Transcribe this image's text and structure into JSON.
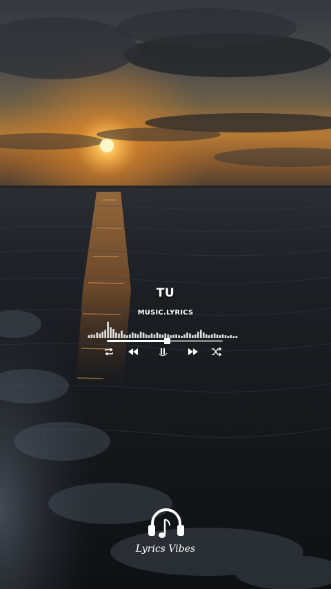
{
  "song": {
    "title": "TU",
    "artist": "MUSIC.LYRICS"
  },
  "player": {
    "progress": 0.52,
    "controls": {
      "repeat_icon": "repeat-icon",
      "previous_icon": "rewind-icon",
      "play_pause_icon": "pause-icon",
      "next_icon": "fast-forward-icon",
      "shuffle_icon": "shuffle-icon"
    },
    "visualizer_levels": [
      0.15,
      0.2,
      0.18,
      0.3,
      0.25,
      0.35,
      0.45,
      0.9,
      0.6,
      0.5,
      0.3,
      0.25,
      0.4,
      0.2,
      0.15,
      0.2,
      0.3,
      0.25,
      0.2,
      0.35,
      0.3,
      0.2,
      0.15,
      0.25,
      0.2,
      0.3,
      0.22,
      0.18,
      0.25,
      0.2,
      0.15,
      0.18,
      0.2,
      0.15,
      0.12,
      0.2,
      0.3,
      0.25,
      0.15,
      0.2,
      0.35,
      0.45,
      0.3,
      0.2,
      0.15,
      0.2,
      0.25,
      0.18,
      0.15,
      0.2,
      0.15,
      0.12,
      0.15,
      0.1,
      0.12
    ]
  },
  "brand": {
    "name": "Lyrics Vibes",
    "logo_icon": "headphones-music-note-icon"
  },
  "colors": {
    "text": "#ffffff",
    "sun": "#ffd56a",
    "sky_top": "#3c4048",
    "sea": "#14171b"
  }
}
